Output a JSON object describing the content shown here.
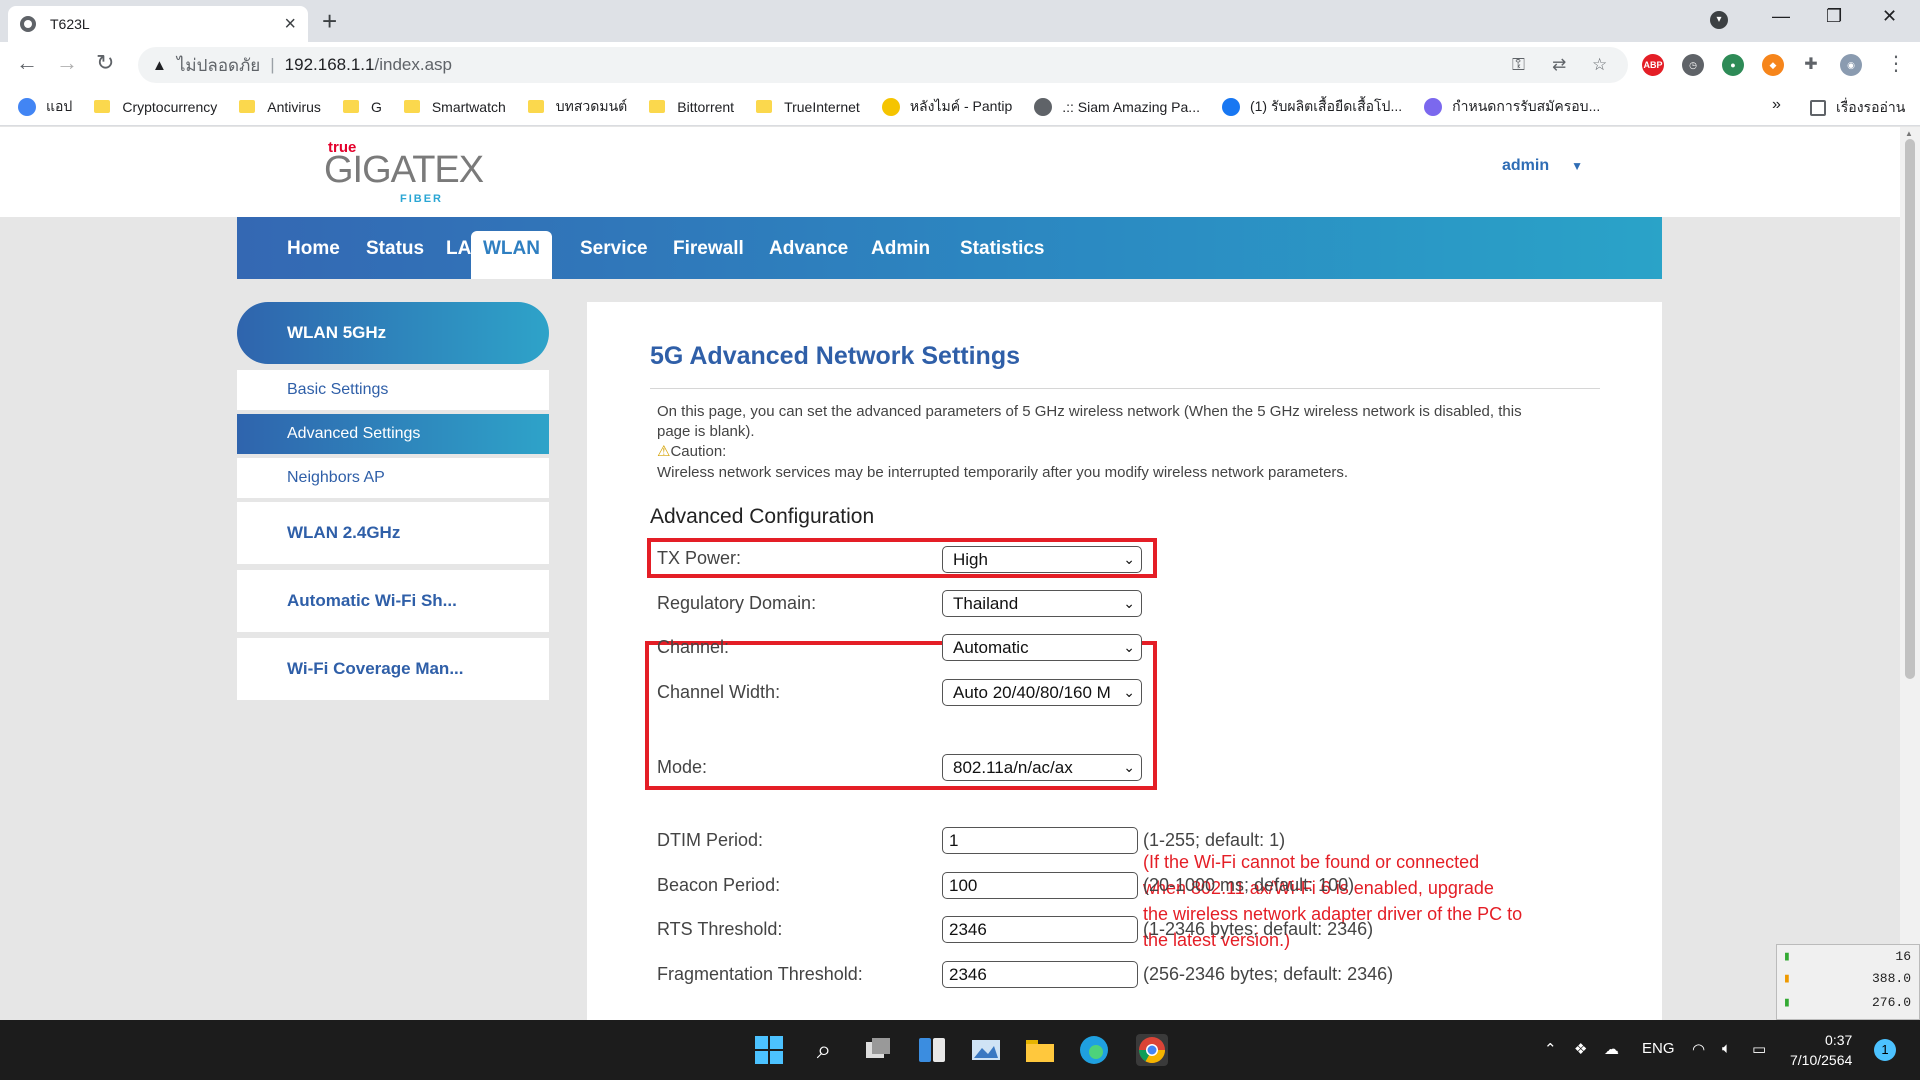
{
  "browser": {
    "tab_title": "T623L",
    "new_tab": "+",
    "url_warning": "ไม่ปลอดภัย",
    "url_host": "192.168.1.1",
    "url_path": "/index.asp",
    "bookmarks": [
      {
        "label": "แอป",
        "icon": "apps-icon"
      },
      {
        "label": "Cryptocurrency",
        "icon": "folder-icon"
      },
      {
        "label": "Antivirus",
        "icon": "folder-icon"
      },
      {
        "label": "G",
        "icon": "folder-icon"
      },
      {
        "label": "Smartwatch",
        "icon": "folder-icon"
      },
      {
        "label": "บทสวดมนต์",
        "icon": "folder-icon"
      },
      {
        "label": "Bittorrent",
        "icon": "folder-icon"
      },
      {
        "label": "TrueInternet",
        "icon": "folder-icon"
      },
      {
        "label": "หลังไมค์ - Pantip",
        "icon": "pantip-icon"
      },
      {
        "label": ".:: Siam Amazing Pa...",
        "icon": "globe-icon"
      },
      {
        "label": "(1) รับผลิตเสื้อยืดเสื้อโป...",
        "icon": "facebook-icon"
      },
      {
        "label": "กำหนดการรับสมัครอบ...",
        "icon": "site-icon"
      }
    ],
    "bookmarks_more": "»",
    "reading_list": "เรื่องรออ่าน"
  },
  "site": {
    "logo_true": "true",
    "logo_main": "GIGATEX",
    "logo_fiber": "FIBER",
    "user": "admin"
  },
  "nav": {
    "items": [
      "Home",
      "Status",
      "LAN",
      "WLAN",
      "Service",
      "Firewall",
      "Advance",
      "Admin",
      "Statistics"
    ],
    "active": "WLAN"
  },
  "sidebar": {
    "header": "WLAN 5GHz",
    "sub_items": [
      "Basic Settings",
      "Advanced Settings",
      "Neighbors AP"
    ],
    "active_sub": "Advanced Settings",
    "groups": [
      "WLAN 2.4GHz",
      "Automatic Wi-Fi Sh...",
      "Wi-Fi Coverage Man..."
    ]
  },
  "content": {
    "title": "5G Advanced Network Settings",
    "desc_line1": "On this page, you can set the advanced parameters of 5 GHz wireless network (When the 5 GHz wireless network is disabled, this",
    "desc_line2": "page is blank).",
    "caution": "Caution:",
    "caution_text": "Wireless network services may be interrupted temporarily after you modify wireless network parameters.",
    "section": "Advanced Configuration",
    "tx_power": {
      "label": "TX Power:",
      "value": "High"
    },
    "regulatory": {
      "label": "Regulatory Domain:",
      "value": "Thailand"
    },
    "channel": {
      "label": "Channel:",
      "value": "Automatic"
    },
    "channel_width": {
      "label": "Channel Width:",
      "value": "Auto 20/40/80/160 M"
    },
    "mode": {
      "label": "Mode:",
      "value": "802.11a/n/ac/ax"
    },
    "mode_note": "(If the Wi-Fi cannot be found or connected when 802.11 ax/Wi-Fi 6 is enabled, upgrade the wireless network adapter driver of the PC to the latest version.)",
    "dtim": {
      "label": "DTIM Period:",
      "value": "1",
      "hint": "(1-255; default: 1)"
    },
    "beacon": {
      "label": "Beacon Period:",
      "value": "100",
      "hint": "(20-1000 ms; default: 100)"
    },
    "rts": {
      "label": "RTS Threshold:",
      "value": "2346",
      "hint": "(1-2346 bytes; default: 2346)"
    },
    "frag": {
      "label": "Fragmentation Threshold:",
      "value": "2346",
      "hint": "(256-2346 bytes; default: 2346)"
    }
  },
  "taskbar": {
    "lang": "ENG",
    "time": "0:37",
    "date": "7/10/2564",
    "notif_count": "1"
  },
  "gadget": {
    "v1": "16",
    "v2": "388.0",
    "v3": "276.0"
  },
  "colors": {
    "accent_blue": "#2f5fa8",
    "highlight_red": "#e41e26",
    "nav_gradient_start": "#3468b3",
    "nav_gradient_end": "#2aa3c8"
  }
}
